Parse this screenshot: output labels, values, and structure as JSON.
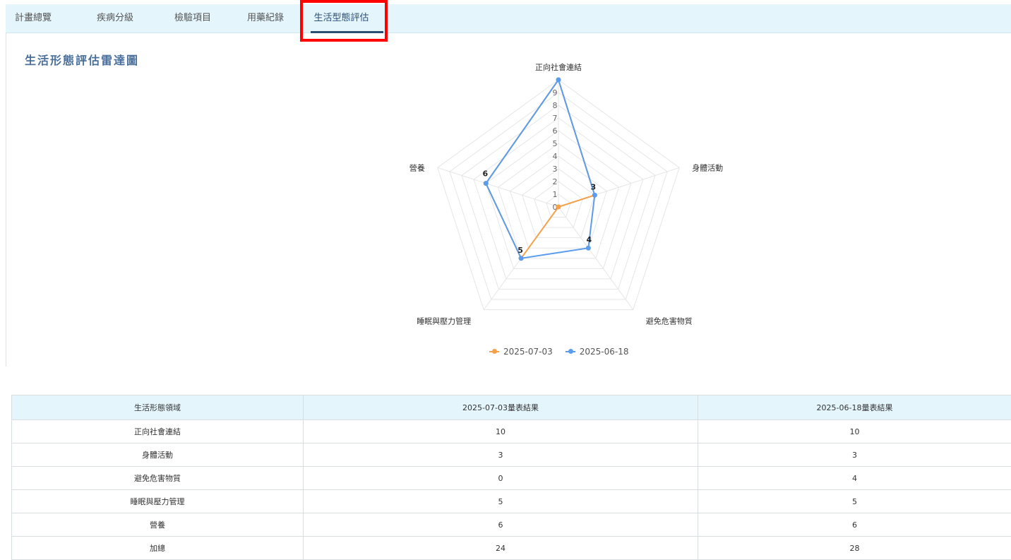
{
  "tabs": [
    {
      "label": "計畫總覽",
      "active": false
    },
    {
      "label": "疾病分級",
      "active": false
    },
    {
      "label": "檢驗項目",
      "active": false
    },
    {
      "label": "用藥紀錄",
      "active": false
    },
    {
      "label": "生活型態評估",
      "active": true
    }
  ],
  "section_title": "生活形態評估雷達圖",
  "chart_data": {
    "type": "radar",
    "indicators": [
      "正向社會連結",
      "身體活動",
      "避免危害物質",
      "睡眠與壓力管理",
      "營養"
    ],
    "max": 10,
    "scale_labels": [
      "0",
      "1",
      "2",
      "3",
      "4",
      "5",
      "6",
      "7",
      "8",
      "9"
    ],
    "series": [
      {
        "name": "2025-07-03",
        "color": "#f5a04a",
        "values": [
          10,
          3,
          0,
          5,
          6
        ]
      },
      {
        "name": "2025-06-18",
        "color": "#5b9cec",
        "values": [
          10,
          3,
          4,
          5,
          6
        ]
      }
    ],
    "point_labels": [
      "3",
      "4",
      "5",
      "6"
    ]
  },
  "table": {
    "headers": [
      "生活形態領域",
      "2025-07-03量表結果",
      "2025-06-18量表結果"
    ],
    "rows": [
      [
        "正向社會連結",
        "10",
        "10"
      ],
      [
        "身體活動",
        "3",
        "3"
      ],
      [
        "避免危害物質",
        "0",
        "4"
      ],
      [
        "睡眠與壓力管理",
        "5",
        "5"
      ],
      [
        "營養",
        "6",
        "6"
      ],
      [
        "加總",
        "24",
        "28"
      ]
    ]
  }
}
